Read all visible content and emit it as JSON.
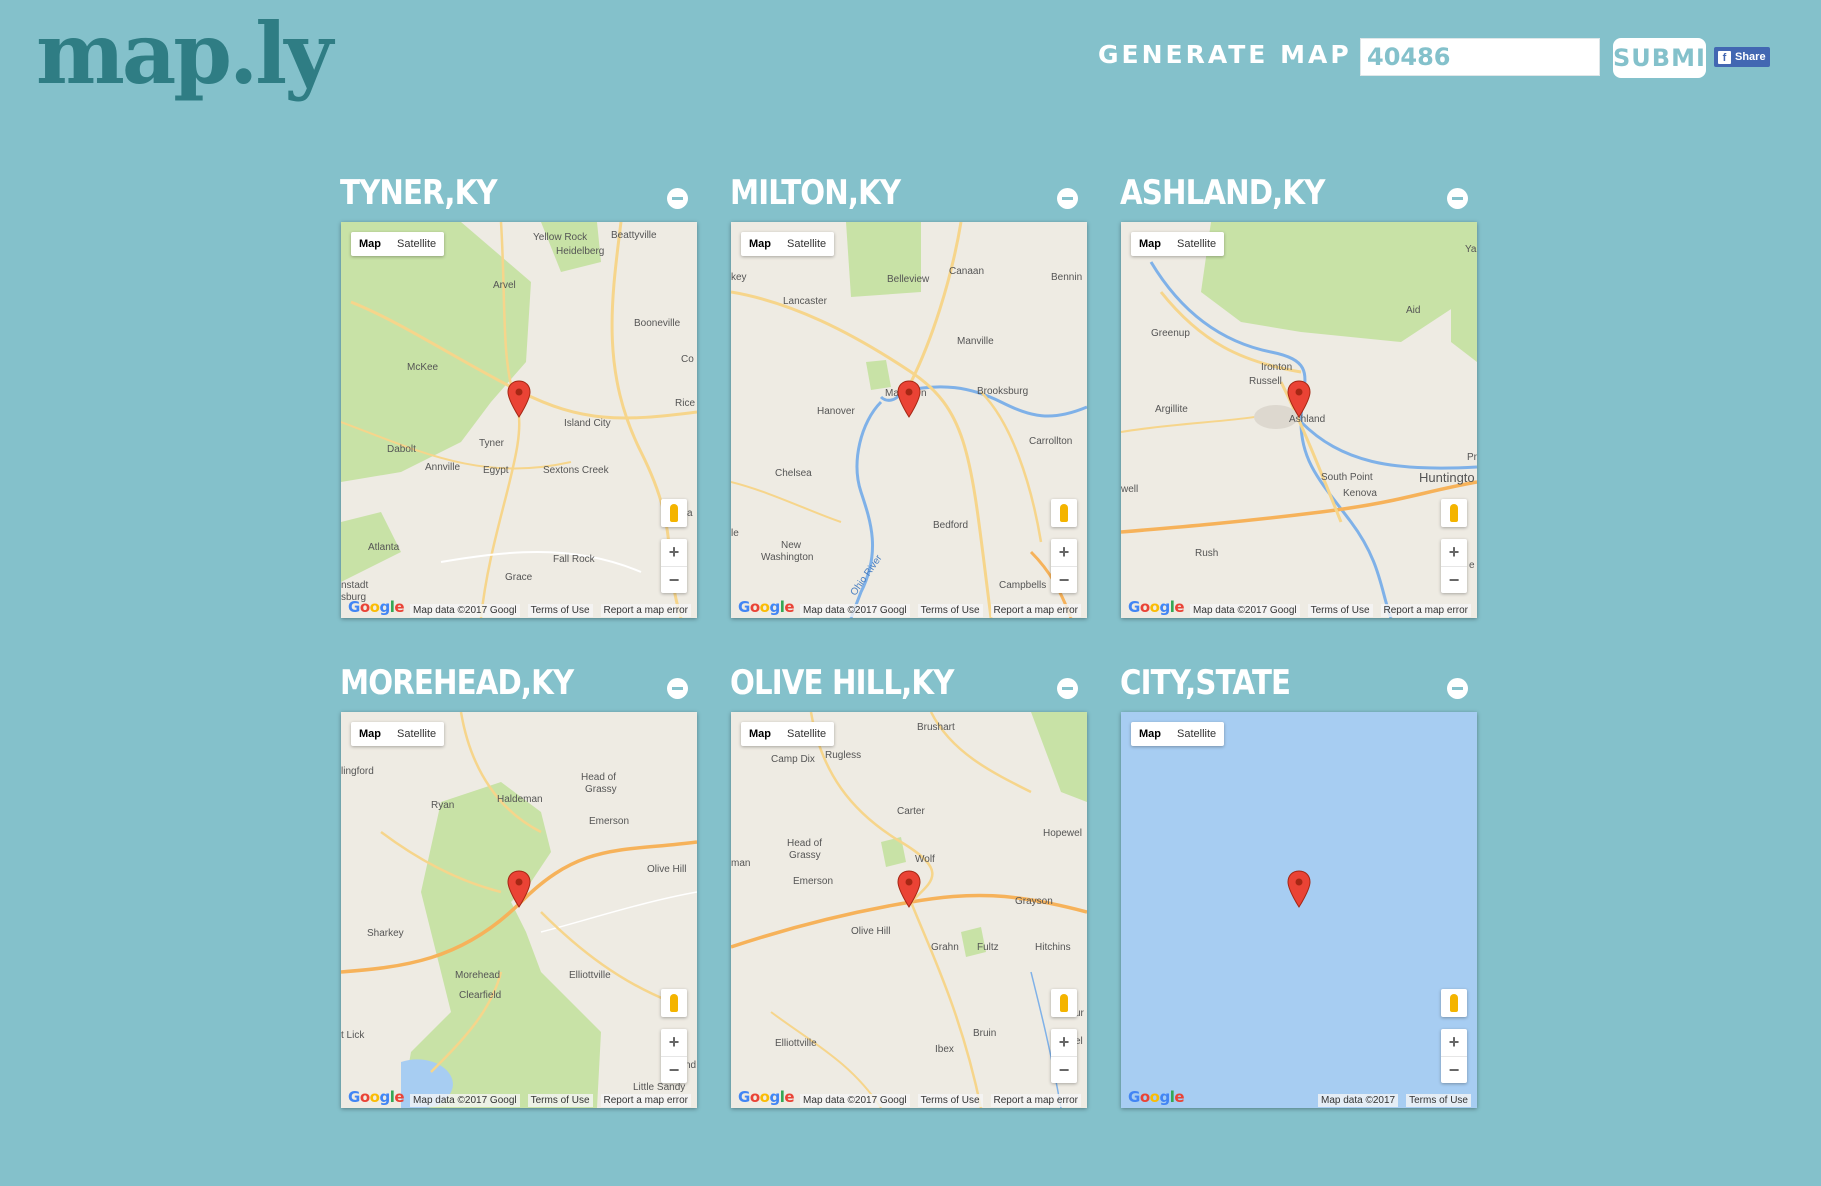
{
  "brand": {
    "logo": "map.ly"
  },
  "generator": {
    "label": "GENERATE MAP FOR:",
    "input_value": "40486",
    "submit_label": "SUBMIT",
    "share_label": "Share"
  },
  "colors": {
    "background": "#84c1cb",
    "logo": "#2f7d84",
    "water": "#a7cdf2",
    "land": "#eeebe3",
    "forest": "#c8e2a6",
    "pin": "#ea4335"
  },
  "map_controls": {
    "map_label": "Map",
    "satellite_label": "Satellite",
    "zoom_in": "+",
    "zoom_out": "−",
    "attribution": "Map data ©2017 Googl",
    "attribution_full": "Map data ©2017",
    "terms": "Terms of Use",
    "report": "Report a map error",
    "logo": [
      "G",
      "o",
      "o",
      "g",
      "l",
      "e"
    ]
  },
  "cards": [
    {
      "title": "TYNER,KY",
      "places": [
        "Yellow Rock",
        "Beattyville",
        "Heidelberg",
        "Arvel",
        "Booneville",
        "McKee",
        "Island City",
        "Tyner",
        "Dabolt",
        "Annville",
        "Egypt",
        "Sextons Creek",
        "Atlanta",
        "Fall Rock",
        "Grace",
        "Rice",
        "Co",
        "a",
        "nstadt",
        "sburg"
      ]
    },
    {
      "title": "MILTON,KY",
      "places": [
        "Belleview",
        "Canaan",
        "Bennin",
        "Lancaster",
        "Manville",
        "Hanover",
        "Ma",
        "n",
        "Brooksburg",
        "Carrollton",
        "Chelsea",
        "Bedford",
        "New",
        "Washington",
        "Ohio River",
        "Campbells",
        "key",
        "le"
      ]
    },
    {
      "title": "ASHLAND,KY",
      "places": [
        "Greenup",
        "Ironton",
        "Russell",
        "Argillite",
        "Ashland",
        "South Point",
        "Huntingto",
        "Kenova",
        "Rush",
        "Aid",
        "Yar",
        "Pr",
        "La",
        "e",
        "well"
      ]
    },
    {
      "title": "MOREHEAD,KY",
      "places": [
        "Head of",
        "Grassy",
        "Haldeman",
        "Ryan",
        "Emerson",
        "Olive Hill",
        "Sharkey",
        "Morehead",
        "Clearfield",
        "Elliottville",
        "Little Sandy",
        "lingford",
        "t Lick",
        "nd"
      ]
    },
    {
      "title": "OLIVE HILL,KY",
      "places": [
        "Brushart",
        "Camp Dix",
        "Rugless",
        "Carter",
        "Hopewel",
        "Head of",
        "Grassy",
        "Wolf",
        "Emerson",
        "Grayson",
        "Olive Hill",
        "Grahn",
        "Fultz",
        "Hitchins",
        "Bruin",
        "Elliottville",
        "Ibex",
        "man",
        "ur",
        "el"
      ]
    },
    {
      "title": "CITY,STATE",
      "places": []
    }
  ]
}
